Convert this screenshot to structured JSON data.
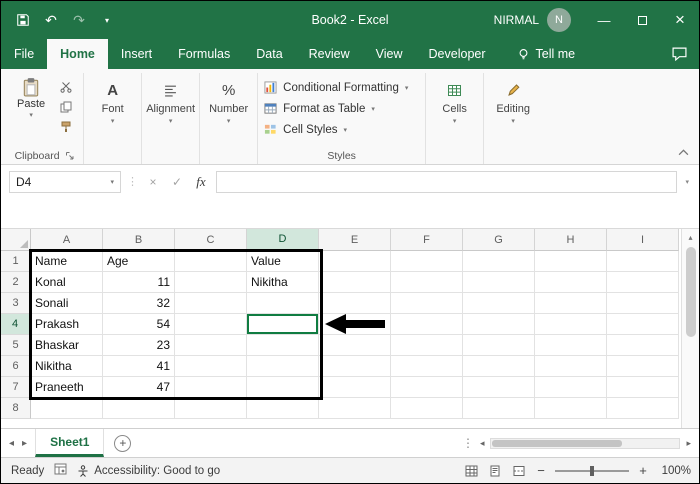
{
  "colors": {
    "accent_green": "#217346",
    "selection_green": "#107c41"
  },
  "icons": {
    "undo": "↶",
    "redo": "↷",
    "caret": "▾",
    "chevron_up": "▴",
    "check": "✓",
    "cancel": "×",
    "dots": "⋮",
    "left": "◂",
    "right": "▸",
    "up": "▴",
    "down": "▾",
    "minus": "−",
    "plus": "+",
    "minimize": "—",
    "close": "×",
    "percent": "%",
    "font_a": "A"
  },
  "title_bar": {
    "title": "Book2 - Excel",
    "user": "NIRMAL",
    "avatar_initial": "N"
  },
  "ribbon_tabs": [
    {
      "label": "File",
      "active": false
    },
    {
      "label": "Home",
      "active": true
    },
    {
      "label": "Insert",
      "active": false
    },
    {
      "label": "Formulas",
      "active": false
    },
    {
      "label": "Data",
      "active": false
    },
    {
      "label": "Review",
      "active": false
    },
    {
      "label": "View",
      "active": false
    },
    {
      "label": "Developer",
      "active": false
    }
  ],
  "search": {
    "label": "Tell me"
  },
  "ribbon": {
    "clipboard": {
      "paste": "Paste",
      "label": "Clipboard"
    },
    "font_label": "Font",
    "alignment_label": "Alignment",
    "number_label": "Number",
    "styles": {
      "items": [
        "Conditional Formatting",
        "Format as Table",
        "Cell Styles"
      ],
      "label": "Styles"
    },
    "cells_label": "Cells",
    "editing_label": "Editing"
  },
  "formula_bar": {
    "name_box": "D4",
    "fx": "fx",
    "value": ""
  },
  "grid": {
    "columns": [
      "A",
      "B",
      "C",
      "D",
      "E",
      "F",
      "G",
      "H",
      "I"
    ],
    "row_count": 8,
    "selected": {
      "col": "D",
      "row": 4,
      "ref": "D4"
    },
    "cells": {
      "A1": "Name",
      "B1": "Age",
      "D1": "Value",
      "A2": "Konal",
      "B2": "11",
      "D2": "Nikitha",
      "A3": "Sonali",
      "B3": "32",
      "A4": "Prakash",
      "B4": "54",
      "A5": "Bhaskar",
      "B5": "23",
      "A6": "Nikitha",
      "B6": "41",
      "A7": "Praneeth",
      "B7": "47"
    }
  },
  "annotations": {
    "box_range": "A1:D7",
    "arrow_target": "D4"
  },
  "sheet_tabs": {
    "active": "Sheet1"
  },
  "status_bar": {
    "ready": "Ready",
    "accessibility": "Accessibility: Good to go",
    "zoom": "100%"
  }
}
